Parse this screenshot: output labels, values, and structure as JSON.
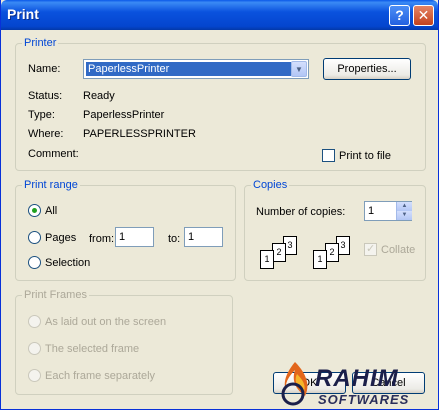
{
  "window": {
    "title": "Print",
    "help_label": "?",
    "close_label": "✕"
  },
  "printer": {
    "legend": "Printer",
    "name_label": "Name:",
    "name_value": "PaperlessPrinter",
    "properties_label": "Properties...",
    "status_label": "Status:",
    "status_value": "Ready",
    "type_label": "Type:",
    "type_value": "PaperlessPrinter",
    "where_label": "Where:",
    "where_value": "PAPERLESSPRINTER",
    "comment_label": "Comment:",
    "print_to_file_label": "Print to file"
  },
  "print_range": {
    "legend": "Print range",
    "all_label": "All",
    "pages_label": "Pages",
    "from_label": "from:",
    "from_value": "1",
    "to_label": "to:",
    "to_value": "1",
    "selection_label": "Selection",
    "selected": "all"
  },
  "copies": {
    "legend": "Copies",
    "number_label": "Number of copies:",
    "number_value": "1",
    "collate_label": "Collate",
    "collate_checked": true,
    "collate_icon_pages": [
      "1",
      "2",
      "3"
    ]
  },
  "print_frames": {
    "legend": "Print Frames",
    "options": [
      "As laid out on the screen",
      "The selected frame",
      "Each frame separately"
    ]
  },
  "buttons": {
    "ok_label": "OK",
    "cancel_label": "Cancel"
  },
  "watermark": {
    "brand": "RAHIM",
    "sub": "SOFTWARES"
  },
  "colors": {
    "titlebar": "#0A52DE",
    "dialog_bg": "#ECE9D8",
    "legend": "#0046D5",
    "selection": "#316AC5"
  }
}
